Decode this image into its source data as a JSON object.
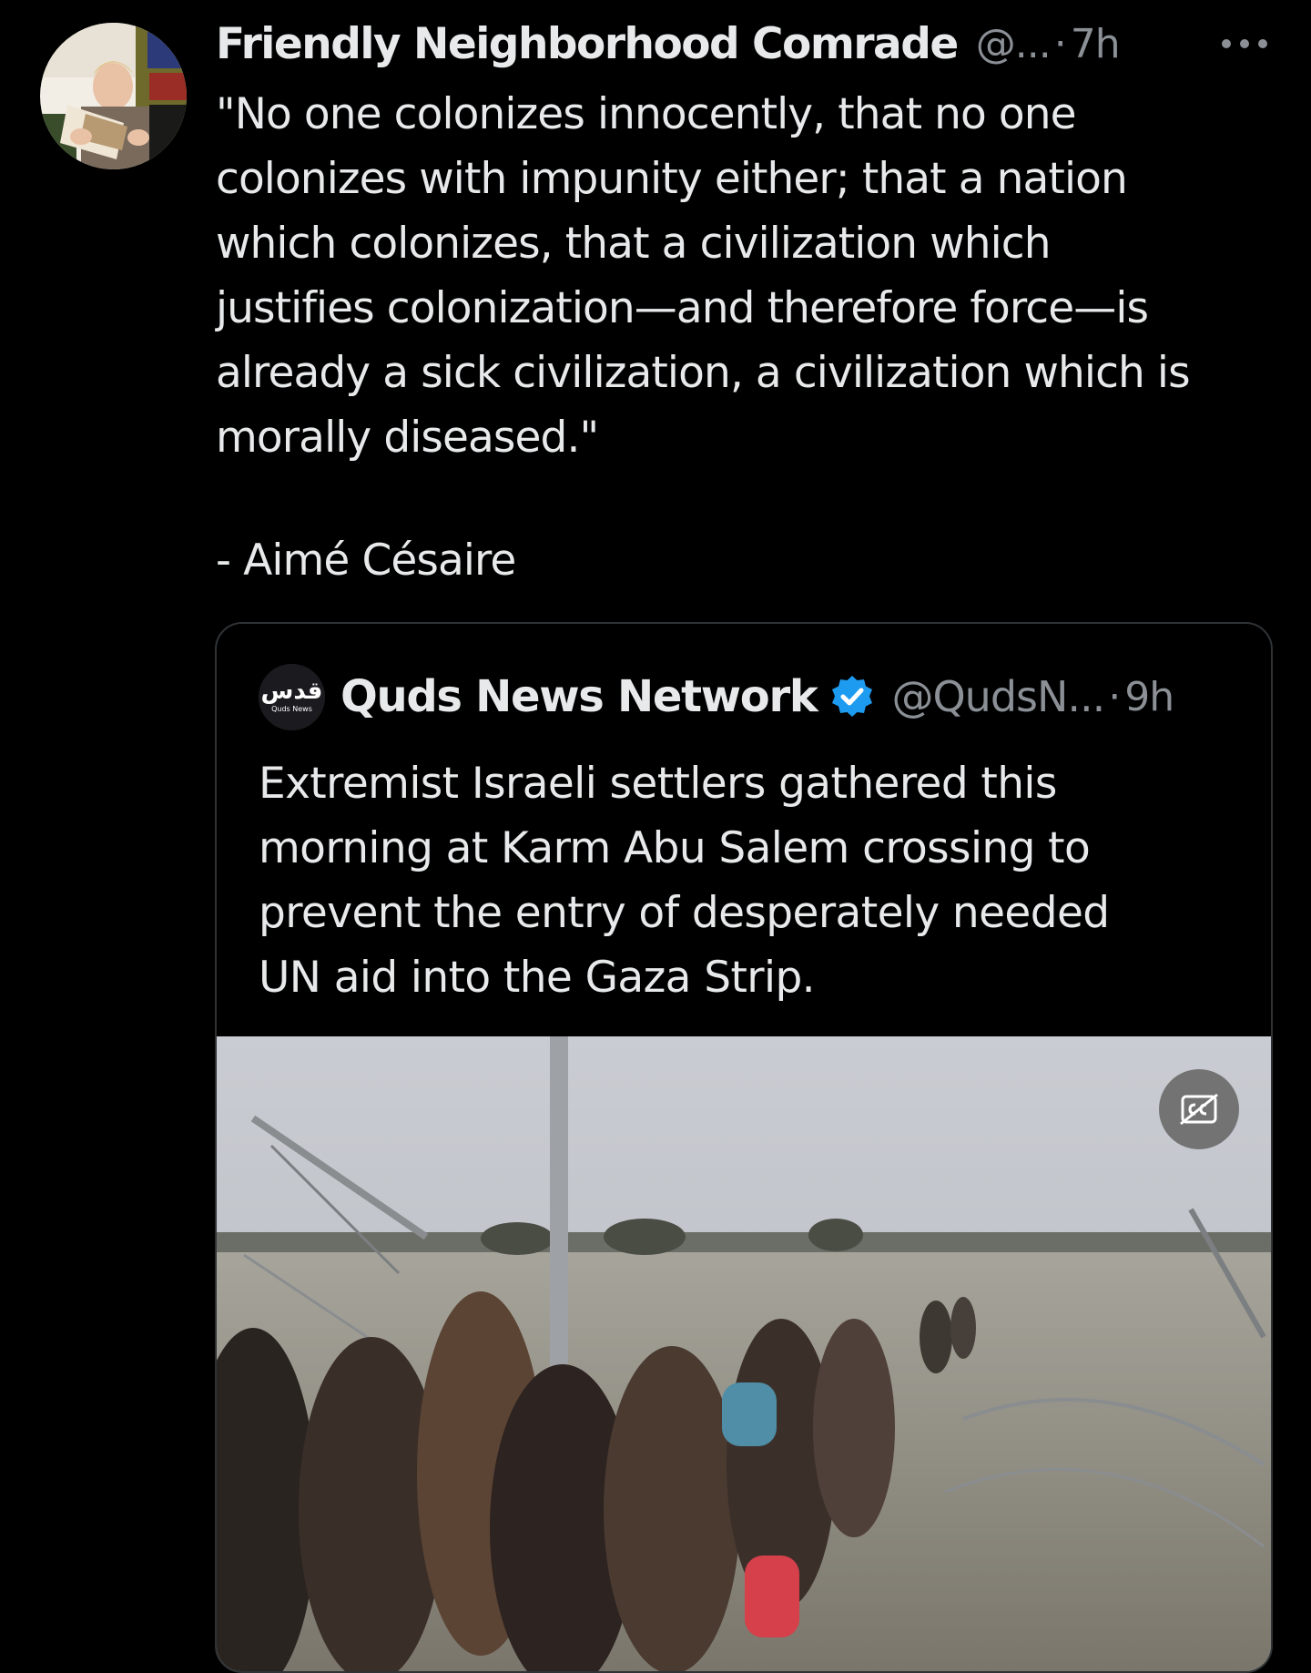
{
  "tweet": {
    "author": {
      "display_name": "Friendly Neighborhood Comrade",
      "handle": "@...",
      "avatar_icon": "profile-photo-person-reading-book"
    },
    "separator": "·",
    "time": "7h",
    "more_icon": "more-horizontal-icon",
    "text": "\"No one colonizes innocently, that no one\ncolonizes with impunity either; that a nation\nwhich colonizes, that a civilization which\njustifies colonization—and therefore force—is\nalready a sick civilization, a civilization which is\nmorally diseased.\"",
    "attribution": "- Aimé Césaire"
  },
  "quoted_tweet": {
    "author": {
      "display_name": "Quds News Network",
      "handle": "@QudsN...",
      "verified": true,
      "avatar_icon": "quds-news-logo",
      "avatar_logo_text": "قدس",
      "avatar_logo_subtext": "Quds News"
    },
    "separator": "·",
    "time": "9h",
    "text": "Extremist Israeli settlers gathered this\nmorning at Karm Abu Salem crossing to\nprevent the entry of desperately needed\nUN aid into the Gaza Strip.",
    "media": {
      "type": "video",
      "description_icon": "video-thumbnail",
      "captions_button_icon": "closed-captions-off-icon"
    }
  },
  "colors": {
    "background": "#000000",
    "primary_text": "#e7e9ea",
    "secondary_text": "#8b9096",
    "border": "#2f3336",
    "verified_blue": "#1d9bf0"
  }
}
